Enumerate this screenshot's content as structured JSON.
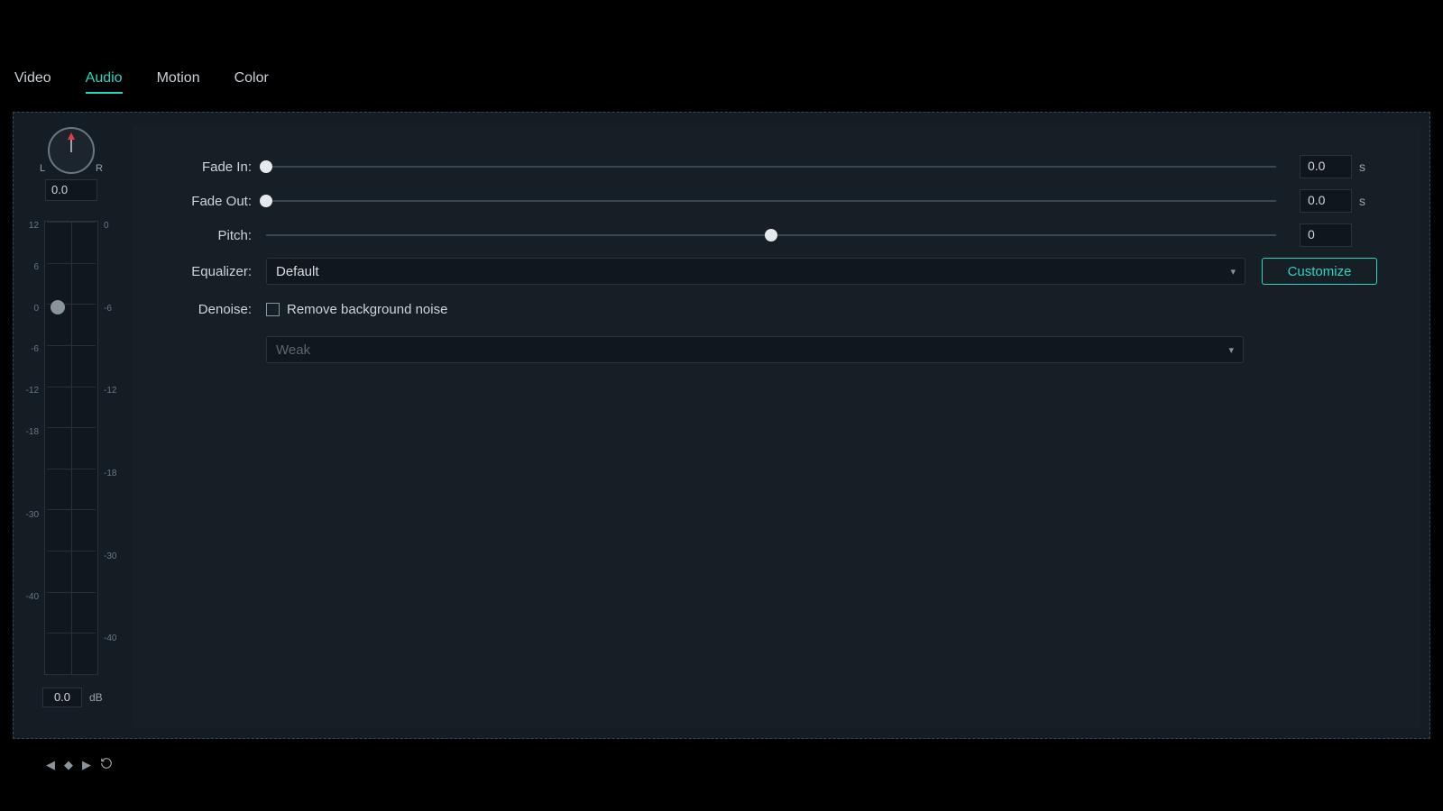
{
  "tabs": {
    "video": "Video",
    "audio": "Audio",
    "motion": "Motion",
    "color": "Color",
    "active": "audio"
  },
  "balance": {
    "left_label": "L",
    "right_label": "R",
    "value": "0.0"
  },
  "meter": {
    "left_ticks": [
      "12",
      "6",
      "0",
      "-6",
      "-12",
      "-18",
      "",
      "-30",
      "",
      "-40",
      "",
      ""
    ],
    "right_ticks": [
      "0",
      "",
      "-6",
      "",
      "-12",
      "",
      "-18",
      "",
      "-30",
      "",
      "-40",
      ""
    ],
    "handle_percent": 19
  },
  "gain": {
    "value": "0.0",
    "unit": "dB"
  },
  "controls": {
    "fade_in": {
      "label": "Fade In:",
      "value": "0.0",
      "unit": "s",
      "thumb_percent": 0
    },
    "fade_out": {
      "label": "Fade Out:",
      "value": "0.0",
      "unit": "s",
      "thumb_percent": 0
    },
    "pitch": {
      "label": "Pitch:",
      "value": "0",
      "thumb_percent": 50
    },
    "equalizer": {
      "label": "Equalizer:",
      "selected": "Default",
      "customize": "Customize"
    },
    "denoise": {
      "label": "Denoise:",
      "checkbox_label": "Remove background noise",
      "checked": false,
      "level_selected": "Weak"
    }
  }
}
